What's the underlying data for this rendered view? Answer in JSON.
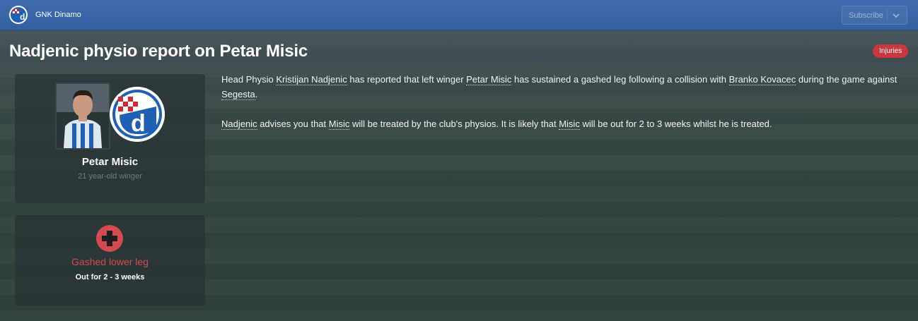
{
  "header": {
    "club_name": "GNK Dinamo",
    "subscribe_label": "Subscribe"
  },
  "news": {
    "title": "Nadjenic physio report on Petar Misic",
    "tag": "Injuries",
    "para1": {
      "t1": "Head Physio ",
      "physio": "Kristijan Nadjenic",
      "t2": " has reported that left winger ",
      "player": "Petar Misic",
      "t3": " has sustained a gashed leg following a collision with ",
      "opponent": "Branko Kovacec",
      "t4": " during the game against ",
      "club": "Segesta",
      "t5": "."
    },
    "para2": {
      "physio": "Nadjenic",
      "t1": " advises you that ",
      "player1": "Misic",
      "t2": " will be treated by the club's physios. It is likely that ",
      "player2": "Misic",
      "t3": " will be out for 2 to 3 weeks whilst he is treated."
    }
  },
  "player_card": {
    "name": "Petar Misic",
    "description": "21 year-old winger"
  },
  "injury_card": {
    "injury": "Gashed lower leg",
    "duration": "Out for 2 - 3 weeks",
    "icon": "medical-cross-icon"
  },
  "colors": {
    "topbar": "#3a66a8",
    "injury_red": "#d44b4f",
    "tag_red": "#c8383e"
  }
}
